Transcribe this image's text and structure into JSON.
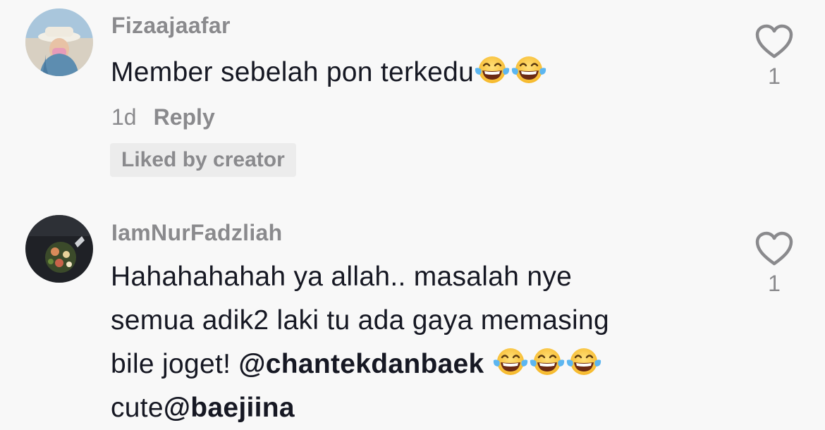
{
  "comments": [
    {
      "username": "Fizaajaafar",
      "text": "Member sebelah pon terkedu",
      "emoji_count": 2,
      "time": "1d",
      "reply_label": "Reply",
      "badge": "Liked by creator",
      "likes": "1"
    },
    {
      "username": "IamNurFadzliah",
      "text_line1": "Hahahahahah ya allah.. masalah nye",
      "text_line2": "semua adik2 laki tu ada gaya memasing",
      "text_line3_pre": "bile joget! ",
      "mention1": "@chantekdanbaek",
      "emoji_count": 3,
      "text_line4_pre": "cute",
      "mention2": "@baejiina",
      "likes": "1"
    }
  ],
  "icons": {
    "like": "heart-outline-icon",
    "emoji": "face-with-tears-of-joy-icon"
  },
  "colors": {
    "background": "#f8f8f8",
    "text": "#161823",
    "secondary": "#8a8a8d",
    "badge_bg": "#ececec"
  }
}
